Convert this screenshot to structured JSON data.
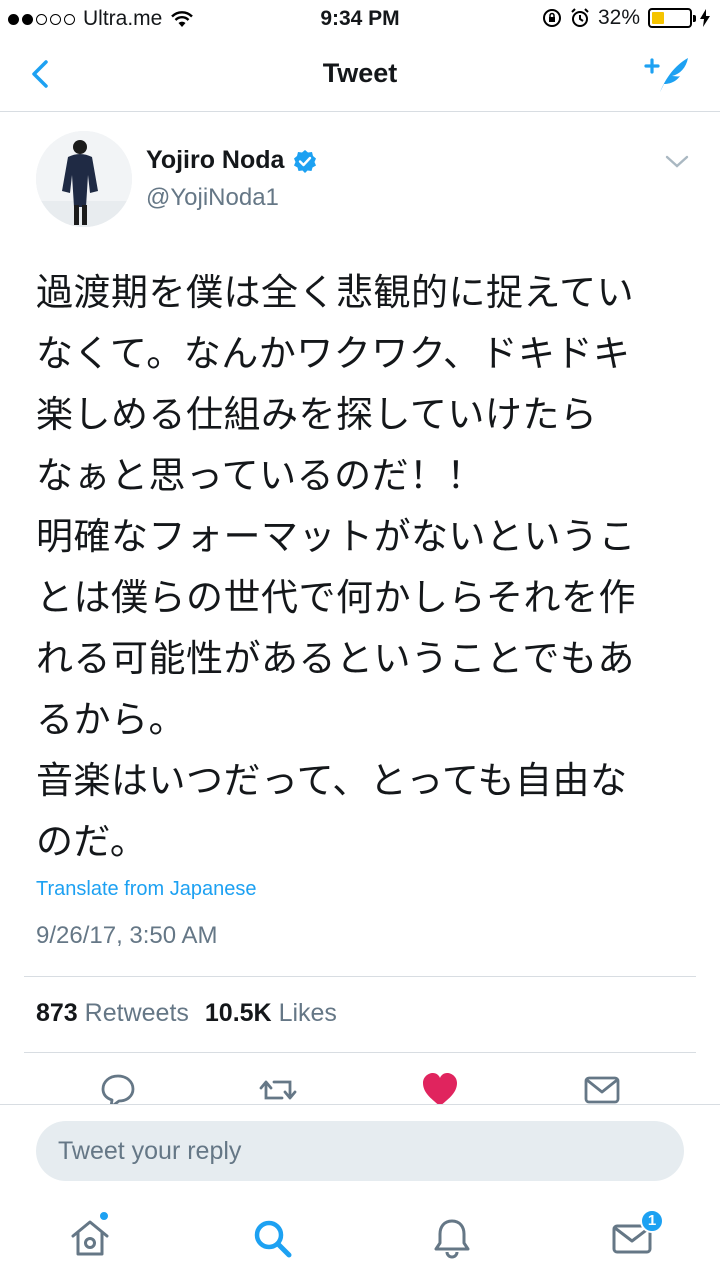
{
  "status_bar": {
    "carrier": "Ultra.me",
    "time": "9:34 PM",
    "battery_percent": "32%",
    "battery_level": 0.32,
    "signal_bars_filled": 2,
    "signal_bars_total": 5
  },
  "nav": {
    "title": "Tweet",
    "back_icon": "chevron-left-icon",
    "compose_icon": "compose-tweet-icon"
  },
  "tweet": {
    "author_name": "Yojiro Noda",
    "verified": true,
    "author_handle": "@YojiNoda1",
    "text": "過渡期を僕は全く悲観的に捉えてい\nなくて。なんかワクワク、ドキドキ\n楽しめる仕組みを探していけたら\nなぁと思っているのだ！！\n明確なフォーマットがないというこ\nとは僕らの世代で何かしらそれを作\nれる可能性があるということでもあ\nるから。\n音楽はいつだって、とっても自由な\nのだ。",
    "translate_label": "Translate from Japanese",
    "timestamp": "9/26/17, 3:50 AM",
    "retweets_count": "873",
    "retweets_label": "Retweets",
    "likes_count": "10.5K",
    "likes_label": "Likes",
    "liked": true
  },
  "reply": {
    "placeholder": "Tweet your reply"
  },
  "tab_bar": {
    "notifications_badge": "1"
  },
  "colors": {
    "accent": "#1da1f2",
    "like": "#e0245e",
    "muted": "#657786",
    "battery": "#f5c400"
  }
}
